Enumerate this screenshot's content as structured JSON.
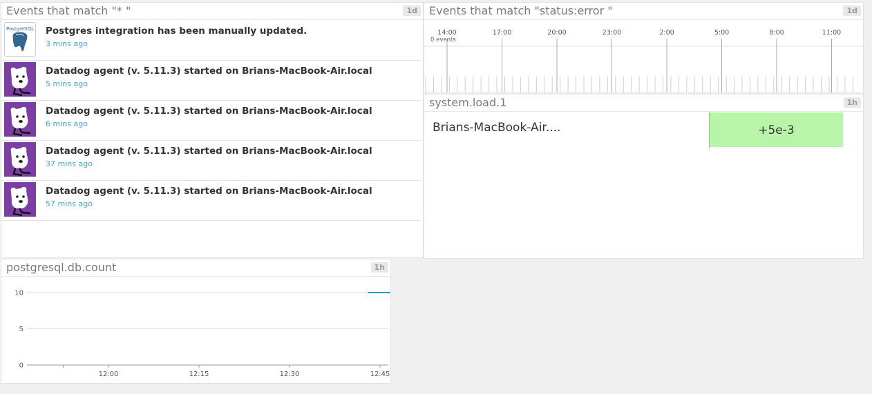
{
  "event_stream": {
    "title": "Events that match \"* \"",
    "timeframe": "1d",
    "events": [
      {
        "icon": "postgres-logo-icon",
        "title": "Postgres integration has been manually updated.",
        "time": "3 mins ago"
      },
      {
        "icon": "datadog-dog-icon",
        "title": "Datadog agent (v. 5.11.3) started on Brians-MacBook-Air.local",
        "time": "5 mins ago"
      },
      {
        "icon": "datadog-dog-icon",
        "title": "Datadog agent (v. 5.11.3) started on Brians-MacBook-Air.local",
        "time": "6 mins ago"
      },
      {
        "icon": "datadog-dog-icon",
        "title": "Datadog agent (v. 5.11.3) started on Brians-MacBook-Air.local",
        "time": "37 mins ago"
      },
      {
        "icon": "datadog-dog-icon",
        "title": "Datadog agent (v. 5.11.3) started on Brians-MacBook-Air.local",
        "time": "57 mins ago"
      }
    ],
    "postgres_logo_text": "PostgreSQL"
  },
  "event_timeline": {
    "title": "Events that match \"status:error \"",
    "timeframe": "1d",
    "ticks": [
      "14:00",
      "17:00",
      "20:00",
      "23:00",
      "2:00",
      "5:00",
      "8:00",
      "11:00"
    ],
    "events_label": "0 events"
  },
  "toplist": {
    "title": "system.load.1",
    "timeframe": "1h",
    "host": "Brians-MacBook-Air....",
    "value": "+5e-3",
    "bar_color": "#b9f5a8"
  },
  "timeseries": {
    "title": "postgresql.db.count",
    "timeframe": "1h",
    "line_color": "#1f9bd1"
  },
  "chart_data": {
    "type": "line",
    "title": "postgresql.db.count",
    "x_ticks": [
      "12:00",
      "12:15",
      "12:30",
      "12:45"
    ],
    "y_ticks": [
      "0",
      "5",
      "10"
    ],
    "ylim": [
      0,
      10
    ],
    "series": [
      {
        "x": [
          "12:43",
          "12:47"
        ],
        "values": [
          10,
          10
        ]
      }
    ],
    "grid": true
  }
}
